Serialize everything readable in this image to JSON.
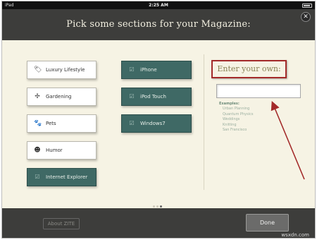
{
  "status": {
    "carrier": "iPad",
    "time": "2:25 AM"
  },
  "header": {
    "title": "Pick some sections for your Magazine:"
  },
  "sections": {
    "col1": [
      {
        "label": "Luxury Lifestyle",
        "icon": "tag-icon",
        "selected": false
      },
      {
        "label": "Gardening",
        "icon": "plant-icon",
        "selected": false
      },
      {
        "label": "Pets",
        "icon": "paw-icon",
        "selected": false
      },
      {
        "label": "Humor",
        "icon": "smiley-icon",
        "selected": false
      },
      {
        "label": "Internet Explorer",
        "icon": "check-icon",
        "selected": true
      }
    ],
    "col2": [
      {
        "label": "iPhone",
        "icon": "check-icon",
        "selected": true
      },
      {
        "label": "iPod Touch",
        "icon": "check-icon",
        "selected": true
      },
      {
        "label": "Windows7",
        "icon": "check-icon",
        "selected": true
      }
    ]
  },
  "custom": {
    "heading": "Enter your own:",
    "input_value": "",
    "examples_label": "Examples:",
    "examples": [
      "Urban Planning",
      "Quantum Physics",
      "Weddings",
      "Knitting",
      "San Francisco"
    ]
  },
  "pagination": {
    "count": 3,
    "active": 3
  },
  "footer": {
    "about_label": "About ZITE",
    "done_label": "Done"
  },
  "watermark": "wsxdn.com",
  "colors": {
    "selected": "#3f6965",
    "header": "#3d3d3b",
    "background": "#f6f3e4",
    "annotation": "#a32a2a"
  }
}
